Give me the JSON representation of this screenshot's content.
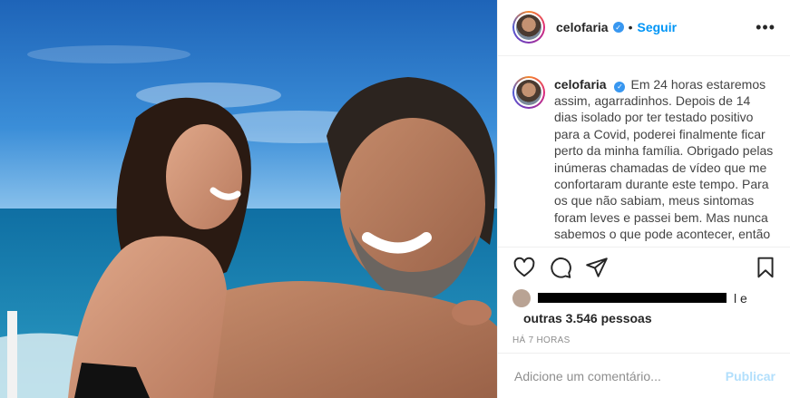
{
  "post": {
    "username": "celofaria",
    "follow_label": "Seguir",
    "separator": "•",
    "more_label": "•••",
    "caption": "Em 24 horas estaremos assim, agarradinhos. Depois de 14 dias isolado por ter testado positivo para a Covid, poderei finalmente ficar perto da minha família. Obrigado pelas inúmeras chamadas de vídeo que me confortaram durante este tempo. Para os que não sabiam, meus sintomas foram leves e passei bem. Mas nunca sabemos o que pode acontecer, então",
    "likes_tail": "l e",
    "likes_others": "outras 3.546 pessoas",
    "timestamp": "HÁ 7 HORAS",
    "comment_placeholder": "Adicione um comentário...",
    "publish_label": "Publicar"
  },
  "icons": {
    "verified": "verified-badge-icon",
    "like": "heart-icon",
    "comment": "comment-bubble-icon",
    "share": "paper-plane-icon",
    "save": "bookmark-icon"
  },
  "colors": {
    "link_blue": "#0095f6",
    "publish_disabled": "#b2dffc",
    "verified_blue": "#3897f0",
    "muted": "#8e8e8e"
  }
}
